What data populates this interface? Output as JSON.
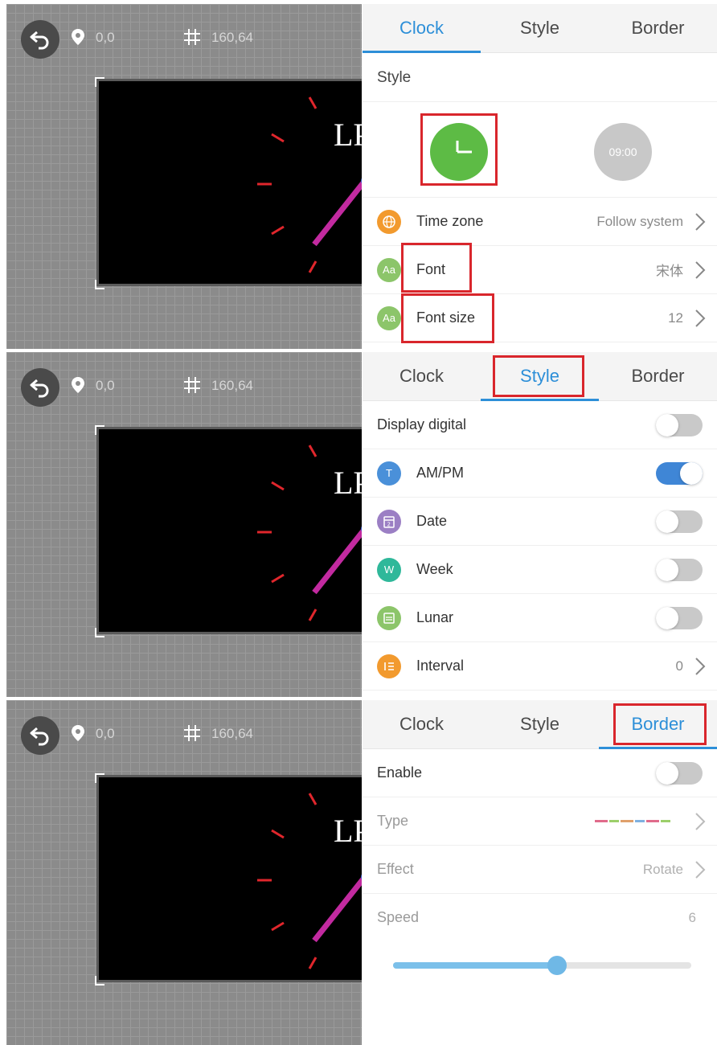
{
  "panels": [
    {
      "canvas": {
        "position": "0,0",
        "size": "160,64"
      },
      "tabs": [
        "Clock",
        "Style",
        "Border"
      ],
      "active_tab": "Clock",
      "style_section": {
        "title": "Style",
        "digital_preview": "09:00"
      },
      "rows": [
        {
          "label": "Time zone",
          "value": "Follow system"
        },
        {
          "label": "Font",
          "value": "宋体"
        },
        {
          "label": "Font size",
          "value": "12"
        }
      ]
    },
    {
      "canvas": {
        "position": "0,0",
        "size": "160,64"
      },
      "tabs": [
        "Clock",
        "Style",
        "Border"
      ],
      "active_tab": "Style",
      "rows": [
        {
          "label": "Display digital",
          "on": false
        },
        {
          "label": "AM/PM",
          "icon_glyph": "T",
          "on": true
        },
        {
          "label": "Date",
          "on": false
        },
        {
          "label": "Week",
          "icon_glyph": "W",
          "on": false
        },
        {
          "label": "Lunar",
          "on": false
        },
        {
          "label": "Interval",
          "value": "0"
        }
      ]
    },
    {
      "canvas": {
        "position": "0,0",
        "size": "160,64"
      },
      "tabs": [
        "Clock",
        "Style",
        "Border"
      ],
      "active_tab": "Border",
      "rows": [
        {
          "label": "Enable",
          "on": false
        },
        {
          "label": "Type"
        },
        {
          "label": "Effect",
          "value": "Rotate"
        },
        {
          "label": "Speed",
          "value": "6"
        }
      ],
      "speed_slider_fraction": 0.55
    }
  ],
  "colors": {
    "accent": "#2d8fd8",
    "highlight_box": "#d9262c",
    "analog_clock": "#5dbb45",
    "toggle_on": "#3f86d6",
    "tick_marks": "#e0262c",
    "minute_hand": "#c22aa0"
  },
  "icons": {
    "back": "undo-arrow-icon",
    "position": "location-pin-icon",
    "size": "hash-grid-icon",
    "time_zone": "globe-icon",
    "font": "font-aa-icon",
    "date": "calendar-icon",
    "lunar": "lunar-calendar-icon",
    "interval": "list-icon"
  }
}
